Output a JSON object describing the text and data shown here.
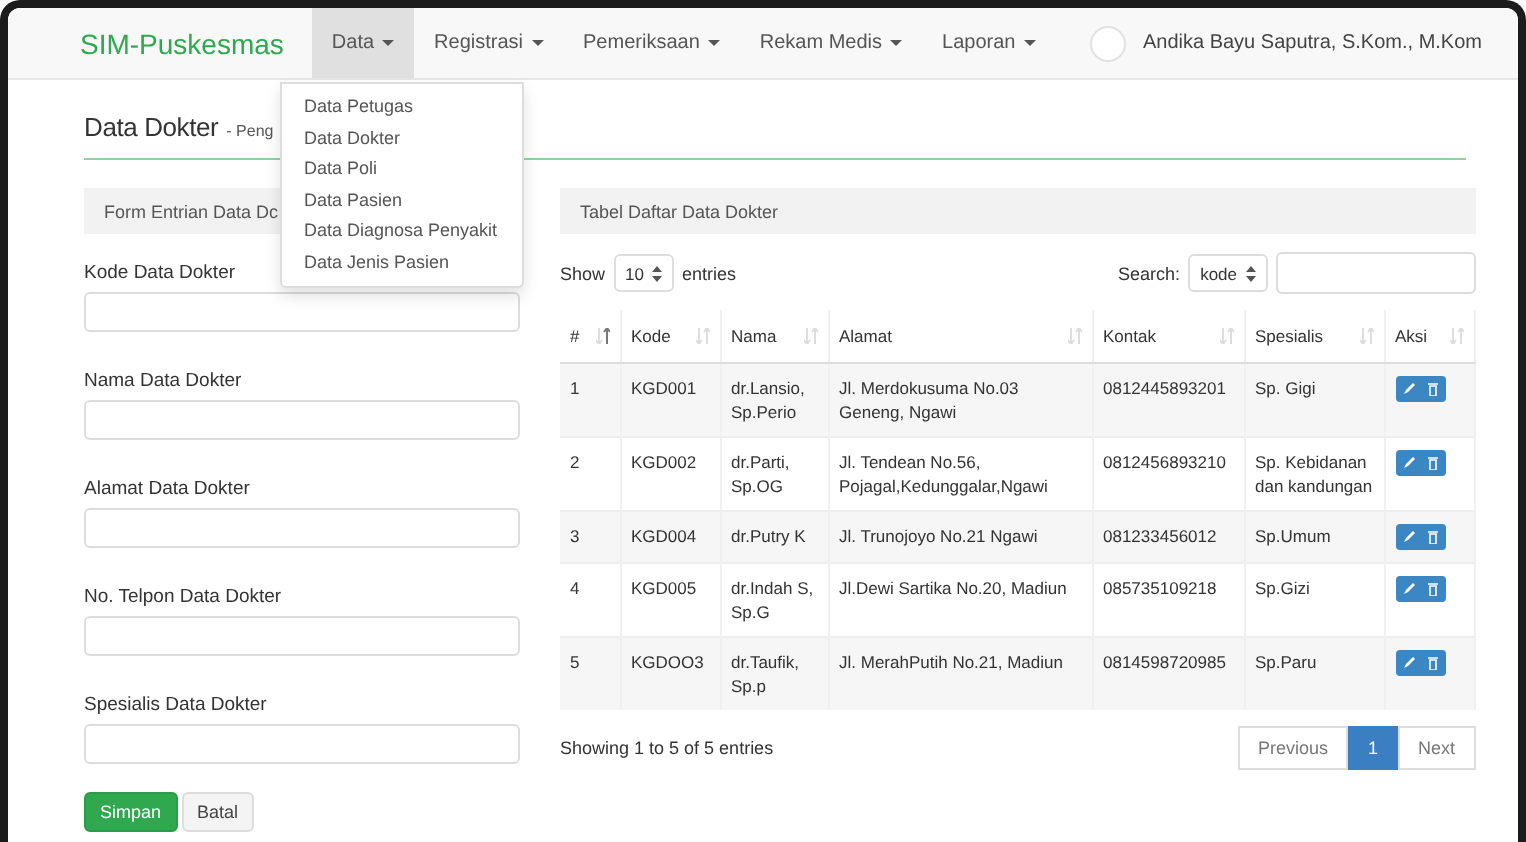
{
  "navbar": {
    "brand": "SIM-Puskesmas",
    "menus": [
      {
        "label": "Data",
        "selected": true
      },
      {
        "label": "Registrasi",
        "selected": false
      },
      {
        "label": "Pemeriksaan",
        "selected": false
      },
      {
        "label": "Rekam Medis",
        "selected": false
      },
      {
        "label": "Laporan",
        "selected": false
      }
    ],
    "user": "Andika Bayu Saputra, S.Kom., M.Kom"
  },
  "dropdown": [
    "Data Petugas",
    "Data Dokter",
    "Data Poli",
    "Data Pasien",
    "Data Diagnosa Penyakit",
    "Data Jenis Pasien"
  ],
  "page": {
    "title": "Data Dokter",
    "subtitle": "- Peng"
  },
  "form": {
    "heading": "Form Entrian Data Dc",
    "fields": [
      "Kode Data Dokter",
      "Nama Data Dokter",
      "Alamat Data Dokter",
      "No. Telpon Data Dokter",
      "Spesialis Data Dokter"
    ],
    "buttons": [
      {
        "label": "Simpan",
        "kind": "primary"
      },
      {
        "label": "Batal",
        "kind": "default"
      }
    ]
  },
  "table": {
    "heading": "Tabel Daftar Data Dokter",
    "show_label": "Show",
    "page_size": "10",
    "entries_label": "entries",
    "search_label": "Search:",
    "search_column": "kode",
    "columns": [
      {
        "label": "#",
        "sorted": true
      },
      {
        "label": "Kode",
        "sorted": false
      },
      {
        "label": "Nama",
        "sorted": false
      },
      {
        "label": "Alamat",
        "sorted": false
      },
      {
        "label": "Kontak",
        "sorted": false
      },
      {
        "label": "Spesialis",
        "sorted": false
      },
      {
        "label": "Aksi",
        "sorted": false
      }
    ],
    "rows": [
      [
        "1",
        "KGD001",
        "dr.Lansio, Sp.Perio",
        "Jl. Merdokusuma No.03 Geneng, Ngawi",
        "0812445893201",
        "Sp. Gigi"
      ],
      [
        "2",
        "KGD002",
        "dr.Parti, Sp.OG",
        "Jl. Tendean No.56, Pojagal,Kedunggalar,Ngawi",
        "0812456893210",
        "Sp. Kebidanan dan kandungan"
      ],
      [
        "3",
        "KGD004",
        "dr.Putry K",
        "Jl. Trunojoyo No.21 Ngawi",
        "081233456012",
        "Sp.Umum"
      ],
      [
        "4",
        "KGD005",
        "dr.Indah S, Sp.G",
        "Jl.Dewi Sartika No.20, Madiun",
        "085735109218",
        "Sp.Gizi"
      ],
      [
        "5",
        "KGDOO3",
        "dr.Taufik, Sp.p",
        "Jl. MerahPutih No.21, Madiun",
        "0814598720985",
        "Sp.Paru"
      ]
    ],
    "info": "Showing 1 to 5 of 5 entries",
    "pagination": [
      {
        "label": "Previous",
        "selected": false
      },
      {
        "label": "1",
        "selected": true
      },
      {
        "label": "Next",
        "selected": false
      }
    ]
  }
}
